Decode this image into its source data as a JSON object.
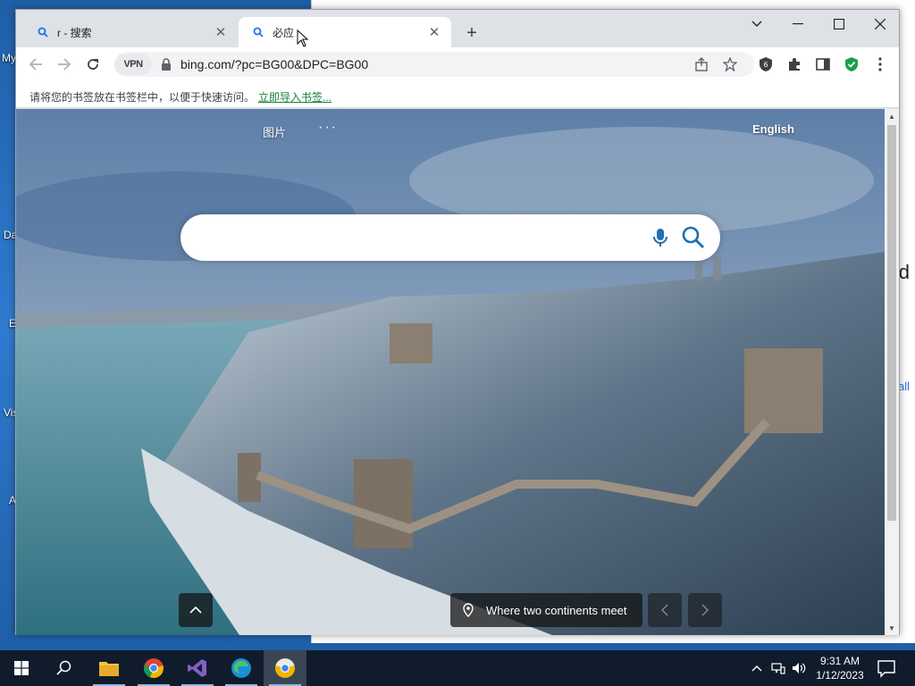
{
  "desktop": {
    "icon_labels": [
      "My",
      "Da",
      "E",
      "Vis",
      "A"
    ]
  },
  "background_window": {
    "heading_fragment": "d",
    "link_fragment": "all"
  },
  "browser": {
    "tabs": [
      {
        "title": "r - 搜索",
        "icon": "search-icon",
        "active": false
      },
      {
        "title": "必应",
        "icon": "search-icon",
        "active": true
      }
    ],
    "window_controls": [
      "chevron-down-icon",
      "minimize-icon",
      "maximize-icon",
      "close-icon"
    ],
    "vpn_label": "VPN",
    "url": "bing.com/?pc=BG00&DPC=BG00",
    "bookmark_bar": {
      "message": "请将您的书签放在书签栏中，以便于快速访问。",
      "import_link": "立即导入书签..."
    }
  },
  "bing": {
    "nav_images": "图片",
    "nav_more": "···",
    "language_link": "English",
    "search": {
      "value": "",
      "placeholder": ""
    },
    "caption": "Where two continents meet"
  },
  "taskbar": {
    "apps": [
      "file-explorer-icon",
      "chrome-icon",
      "visual-studio-icon",
      "edge-icon",
      "chrome-active-icon"
    ],
    "clock_time": "9:31 AM",
    "clock_date": "1/12/2023"
  }
}
